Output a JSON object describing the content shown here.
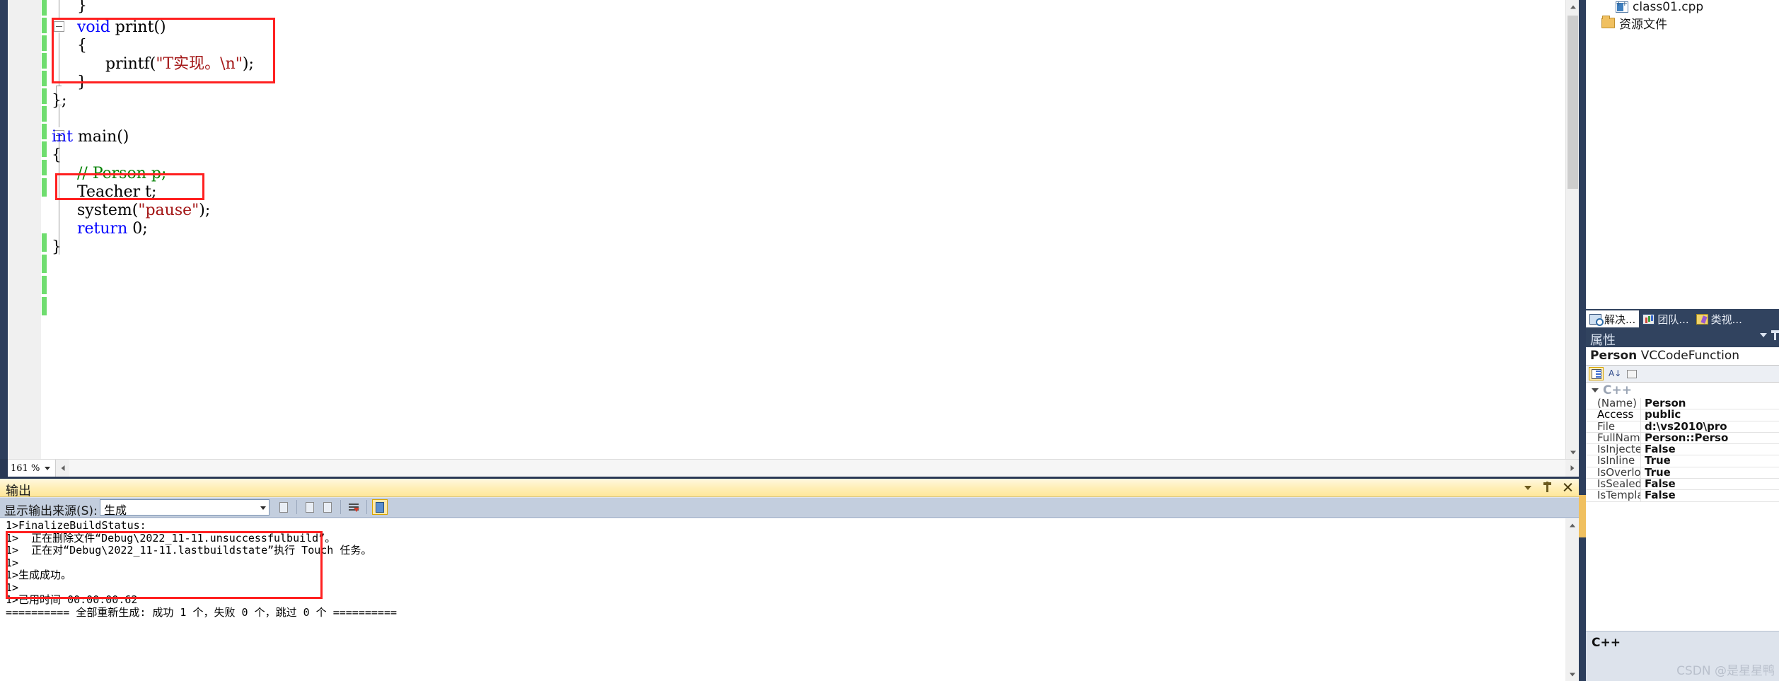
{
  "editor": {
    "zoom_level": "161 %",
    "code_lines": [
      {
        "indent": 2,
        "segments": [
          {
            "t": "}",
            "c": "plain"
          }
        ]
      },
      {
        "indent": 1,
        "segments": [
          {
            "t": "void",
            "c": "kw"
          },
          {
            "t": " print()",
            "c": "plain"
          }
        ]
      },
      {
        "indent": 1,
        "segments": [
          {
            "t": "{",
            "c": "plain"
          }
        ]
      },
      {
        "indent": 2,
        "segments": [
          {
            "t": "printf(",
            "c": "plain"
          },
          {
            "t": "\"T实现。\\n\"",
            "c": "str"
          },
          {
            "t": ");",
            "c": "plain"
          }
        ]
      },
      {
        "indent": 1,
        "segments": [
          {
            "t": "}",
            "c": "plain"
          }
        ]
      },
      {
        "indent": 0,
        "segments": [
          {
            "t": "};",
            "c": "plain"
          }
        ]
      },
      {
        "indent": 0,
        "segments": []
      },
      {
        "indent": 0,
        "segments": [
          {
            "t": "int",
            "c": "kw"
          },
          {
            "t": " main()",
            "c": "plain"
          }
        ]
      },
      {
        "indent": 0,
        "segments": [
          {
            "t": "{",
            "c": "plain"
          }
        ]
      },
      {
        "indent": 1,
        "segments": [
          {
            "t": "// Person p;",
            "c": "cmt"
          }
        ]
      },
      {
        "indent": 1,
        "segments": [
          {
            "t": "Teacher t;",
            "c": "plain"
          }
        ]
      },
      {
        "indent": 1,
        "segments": [
          {
            "t": "system(",
            "c": "plain"
          },
          {
            "t": "\"pause\"",
            "c": "str"
          },
          {
            "t": ");",
            "c": "plain"
          }
        ]
      },
      {
        "indent": 1,
        "segments": [
          {
            "t": "return",
            "c": "kw"
          },
          {
            "t": " 0;",
            "c": "plain"
          }
        ]
      },
      {
        "indent": 0,
        "segments": [
          {
            "t": "}",
            "c": "plain"
          }
        ]
      }
    ],
    "annotation_color": "#ff2020"
  },
  "output": {
    "title": "输出",
    "source_label": "显示输出来源(S):",
    "source_value": "生成",
    "lines": [
      "1>FinalizeBuildStatus:",
      "1>  正在删除文件“Debug\\2022_11-11.unsuccessfulbuild”。",
      "1>  正在对“Debug\\2022_11-11.lastbuildstate”执行 Touch 任务。",
      "1>",
      "1>生成成功。",
      "1>",
      "1>已用时间 00:00:00.62",
      "========== 全部重新生成: 成功 1 个，失败 0 个，跳过 0 个 =========="
    ]
  },
  "solution_explorer": {
    "items": [
      {
        "label": "class01.cpp",
        "icon": "cpp-file-icon",
        "indent": 42
      },
      {
        "label": "资源文件",
        "icon": "folder-icon",
        "indent": 22
      }
    ]
  },
  "panel_tabs": [
    {
      "label": "解决...",
      "active": true
    },
    {
      "label": "团队...",
      "active": false
    },
    {
      "label": "类视...",
      "active": false
    }
  ],
  "properties": {
    "header": "属性",
    "object_name": "Person",
    "object_type": "VCCodeFunction",
    "group": "C++",
    "rows": [
      {
        "key": "(Name)",
        "value": "Person"
      },
      {
        "key": "Access",
        "value": "public"
      },
      {
        "key": "File",
        "value": "d:\\vs2010\\pro"
      },
      {
        "key": "FullName",
        "value": "Person::Perso"
      },
      {
        "key": "IsInjected",
        "value": "False"
      },
      {
        "key": "IsInline",
        "value": "True"
      },
      {
        "key": "IsOverloaded",
        "value": "True"
      },
      {
        "key": "IsSealed",
        "value": "False"
      },
      {
        "key": "IsTemplate",
        "value": "False"
      }
    ],
    "description_title": "C++"
  },
  "watermark": "CSDN @是星星鸭"
}
